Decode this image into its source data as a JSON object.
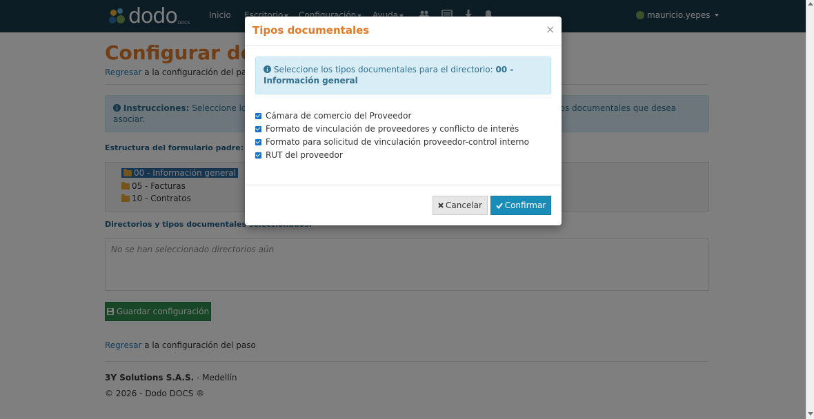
{
  "navbar": {
    "logo_text": "dodo",
    "logo_sub": "DOCS",
    "items": [
      {
        "label": "Inicio"
      },
      {
        "label": "Escritorio"
      },
      {
        "label": "Configuración"
      },
      {
        "label": "Ayuda"
      }
    ],
    "icons": [
      "users-icon",
      "newspaper-icon",
      "download-icon",
      "bell-icon"
    ],
    "user": "mauricio.yepes"
  },
  "page": {
    "title": "Configurar documentos",
    "back_link": "Regresar",
    "back_text": " a la configuración del paso",
    "instructions_label": "Instrucciones:",
    "instructions_text": " Seleccione los directorios de la estructura del formulario padre y luego seleccione los tipos documentales que desea asociar.",
    "tree_label": "Estructura del formulario padre:",
    "tree": [
      {
        "label": "00 - Información general",
        "selected": true
      },
      {
        "label": "05 - Facturas",
        "selected": false
      },
      {
        "label": "10 - Contratos",
        "selected": false
      }
    ],
    "selected_label": "Directorios y tipos documentales seleccionados:",
    "empty_text": "No se han seleccionado directorios aún",
    "save_button": "Guardar configuración",
    "back_link_2": "Regresar",
    "back_text_2": " a la configuración del paso"
  },
  "footer": {
    "company": "3Y Solutions S.A.S.",
    "city": " - Medellín",
    "copyright": "© 2026 - Dodo DOCS ®"
  },
  "modal": {
    "title": "Tipos documentales",
    "close": "×",
    "alert_text": "Seleccione los tipos documentales para el directorio: ",
    "alert_bold": "00 - Información general",
    "options": [
      {
        "label": "Cámara de comercio del Proveedor",
        "checked": true
      },
      {
        "label": "Formato de vinculación de proveedores y conflicto de interés",
        "checked": true
      },
      {
        "label": "Formato para solicitud de vinculación proveedor-control interno",
        "checked": true
      },
      {
        "label": "RUT del proveedor",
        "checked": true
      }
    ],
    "cancel": "Cancelar",
    "confirm": "Confirmar"
  },
  "colors": {
    "navbar": "#1b3a4b",
    "title": "#e07b2a",
    "link": "#2a7db5",
    "success": "#2f8f4e",
    "primary": "#1a8cb8"
  }
}
